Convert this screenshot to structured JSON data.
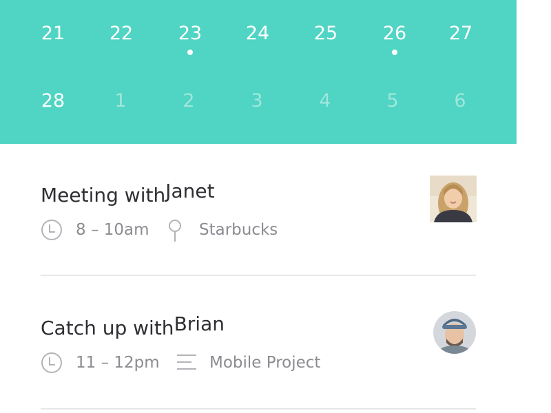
{
  "calendar": {
    "week1": [
      {
        "day": "21",
        "dot": false,
        "dim": false
      },
      {
        "day": "22",
        "dot": false,
        "dim": false
      },
      {
        "day": "23",
        "dot": true,
        "dim": false
      },
      {
        "day": "24",
        "dot": false,
        "dim": false
      },
      {
        "day": "25",
        "dot": false,
        "dim": false
      },
      {
        "day": "26",
        "dot": true,
        "dim": false
      },
      {
        "day": "27",
        "dot": false,
        "dim": false
      }
    ],
    "week2": [
      {
        "day": "28",
        "dot": false,
        "dim": false
      },
      {
        "day": "1",
        "dot": false,
        "dim": true
      },
      {
        "day": "2",
        "dot": false,
        "dim": true
      },
      {
        "day": "3",
        "dot": false,
        "dim": true
      },
      {
        "day": "4",
        "dot": false,
        "dim": true
      },
      {
        "day": "5",
        "dot": false,
        "dim": true
      },
      {
        "day": "6",
        "dot": false,
        "dim": true
      }
    ],
    "accent_color": "#50d4c3"
  },
  "events": [
    {
      "title_prefix": "Meeting with",
      "title_name": "Janet",
      "time": "8 – 10am",
      "time_icon": "clock-icon",
      "detail": "Starbucks",
      "detail_icon": "location-pin-icon"
    },
    {
      "title_prefix": "Catch up with",
      "title_name": "Brian",
      "time": "11 – 12pm",
      "time_icon": "clock-icon",
      "detail": "Mobile Project",
      "detail_icon": "notes-icon"
    }
  ]
}
